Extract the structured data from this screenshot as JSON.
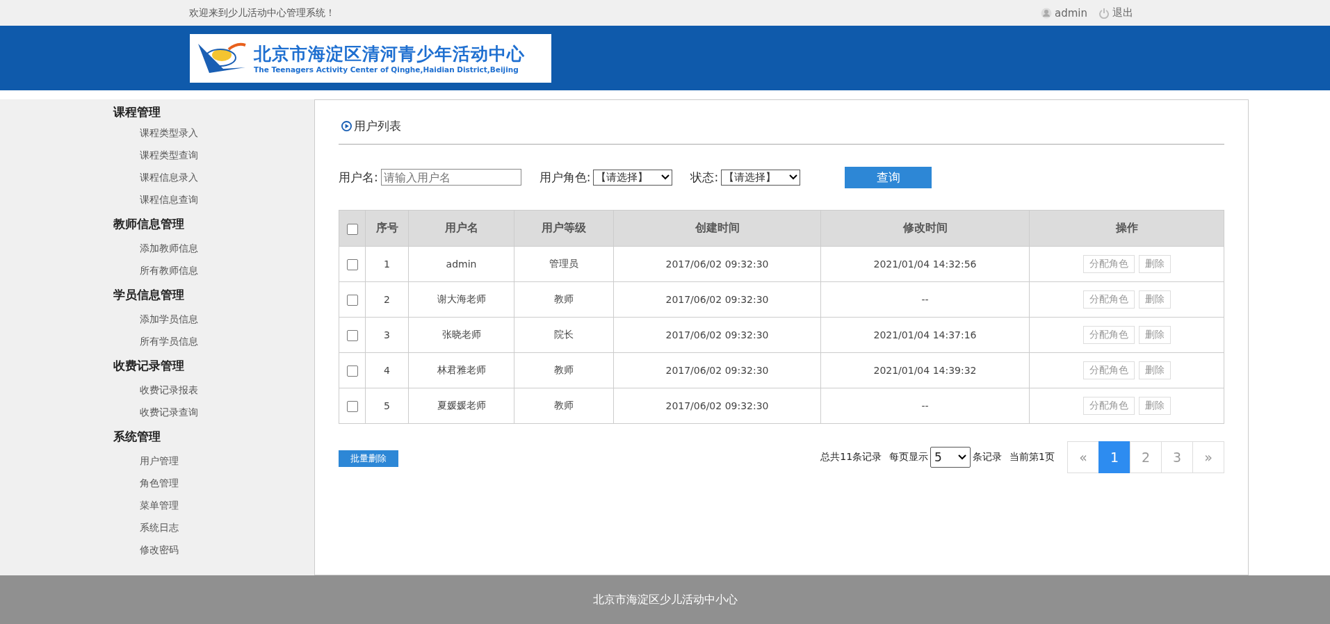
{
  "top_bar": {
    "welcome": "欢迎来到少儿活动中心管理系统！",
    "user": "admin",
    "logout": "退出"
  },
  "logo": {
    "title": "北京市海淀区清河青少年活动中心",
    "subtitle": "The Teenagers Activity Center of Qinghe,Haidian District,Beijing"
  },
  "sidebar": {
    "groups": [
      {
        "title": "课程管理",
        "items": [
          {
            "label": "课程类型录入",
            "selected": false
          },
          {
            "label": "课程类型查询",
            "selected": false
          },
          {
            "label": "课程信息录入",
            "selected": false
          },
          {
            "label": "课程信息查询",
            "selected": false
          }
        ]
      },
      {
        "title": "教师信息管理",
        "items": [
          {
            "label": "添加教师信息",
            "selected": false
          },
          {
            "label": "所有教师信息",
            "selected": false
          }
        ]
      },
      {
        "title": "学员信息管理",
        "items": [
          {
            "label": "添加学员信息",
            "selected": false
          },
          {
            "label": "所有学员信息",
            "selected": false
          }
        ]
      },
      {
        "title": "收费记录管理",
        "items": [
          {
            "label": "收费记录报表",
            "selected": false
          },
          {
            "label": "收费记录查询",
            "selected": false
          }
        ]
      },
      {
        "title": "系统管理",
        "items": [
          {
            "label": "用户管理",
            "selected": false
          },
          {
            "label": "角色管理",
            "selected": false
          },
          {
            "label": "菜单管理",
            "selected": false
          },
          {
            "label": "系统日志",
            "selected": false
          },
          {
            "label": "修改密码",
            "selected": false
          }
        ]
      }
    ]
  },
  "panel_title": "用户列表",
  "filters": {
    "username_label": "用户名:",
    "username_placeholder": "请输入用户名",
    "role_label": "用户角色:",
    "role_value": "【请选择】",
    "status_label": "状态:",
    "status_value": "【请选择】",
    "search_button": "查询"
  },
  "table": {
    "select_all_checked": false,
    "columns": [
      "序号",
      "用户名",
      "用户等级",
      "创建时间",
      "修改时间",
      "操作"
    ],
    "rows": [
      {
        "checked": false,
        "cells": [
          "1",
          "admin",
          "管理员",
          "2017/06/02 09:32:30",
          "2021/01/04 14:32:56"
        ],
        "actions": [
          "分配角色",
          "删除"
        ]
      },
      {
        "checked": false,
        "cells": [
          "2",
          "谢大海老师",
          "教师",
          "2017/06/02 09:32:30",
          "--"
        ],
        "actions": [
          "分配角色",
          "删除"
        ]
      },
      {
        "checked": false,
        "cells": [
          "3",
          "张晓老师",
          "院长",
          "2017/06/02 09:32:30",
          "2021/01/04 14:37:16"
        ],
        "actions": [
          "分配角色",
          "删除"
        ]
      },
      {
        "checked": false,
        "cells": [
          "4",
          "林君雅老师",
          "教师",
          "2017/06/02 09:32:30",
          "2021/01/04 14:39:32"
        ],
        "actions": [
          "分配角色",
          "删除"
        ]
      },
      {
        "checked": false,
        "cells": [
          "5",
          "夏媛媛老师",
          "教师",
          "2017/06/02 09:32:30",
          "--"
        ],
        "actions": [
          "分配角色",
          "删除"
        ]
      }
    ]
  },
  "batch_delete": "批量删除",
  "pagination": {
    "total": "总共11条记录",
    "per_page_label": "每页显示",
    "per_page_value": "5",
    "per_page_suffix": "条记录",
    "current": "当前第1页",
    "prev": "«",
    "next": "»",
    "pages": [
      {
        "label": "1",
        "selected": true
      },
      {
        "label": "2",
        "selected": false
      },
      {
        "label": "3",
        "selected": false
      }
    ]
  },
  "footer": "北京市海淀区少儿活动中小心"
}
